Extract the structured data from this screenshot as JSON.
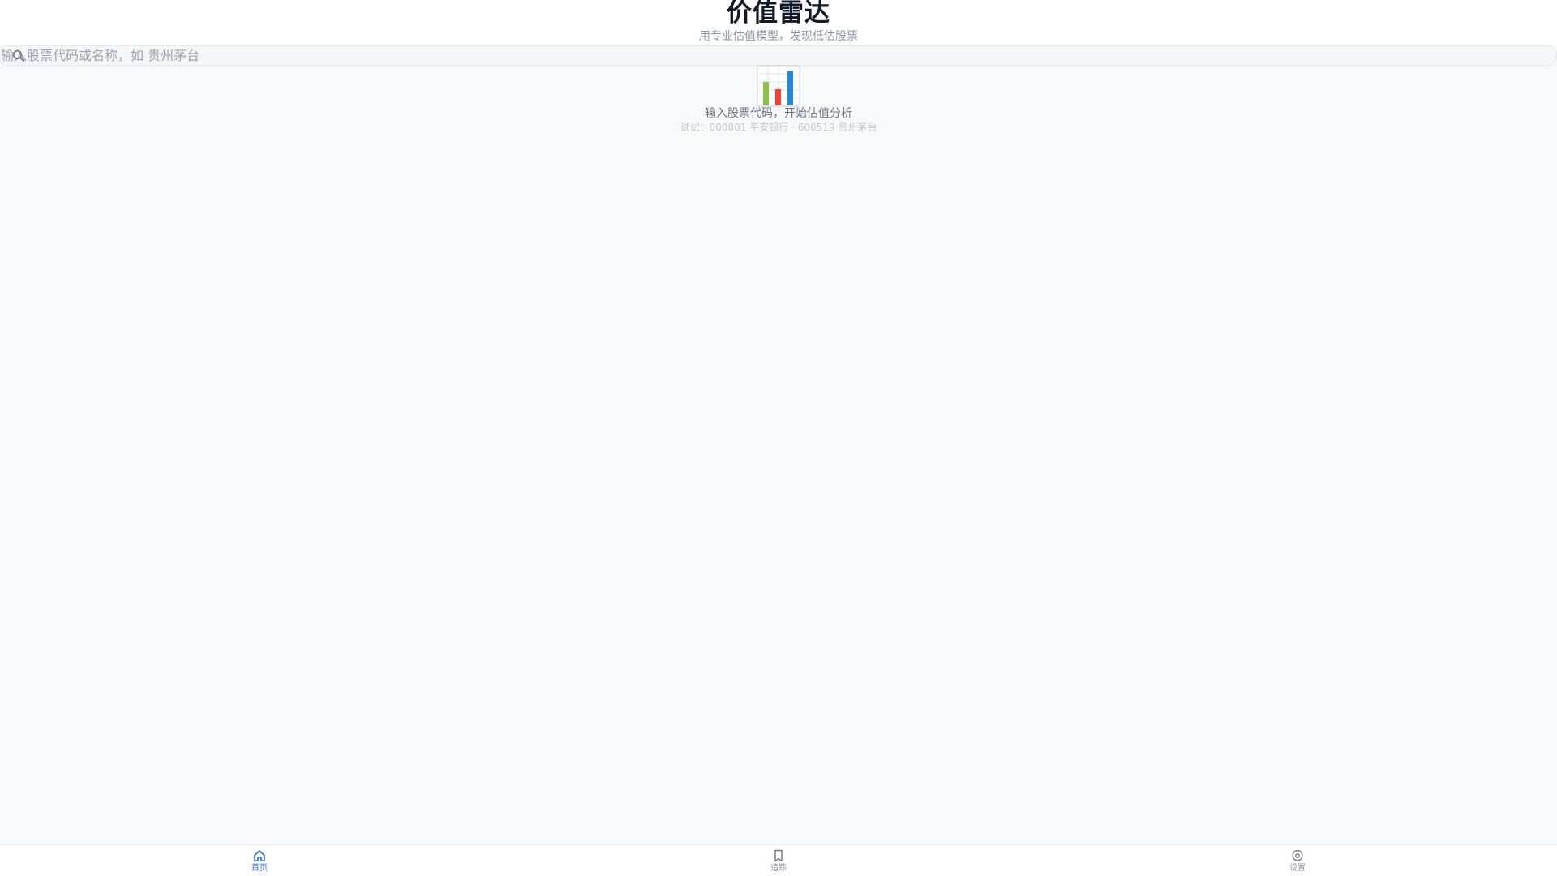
{
  "header": {
    "title": "价值雷达",
    "subtitle": "用专业估值模型，发现低估股票"
  },
  "search": {
    "placeholder": "输入股票代码或名称，如 贵州茅台",
    "icon": "search-icon"
  },
  "empty_state": {
    "icon": "bar-chart-icon",
    "title": "输入股票代码，开始估值分析",
    "hint": "试试：000001 平安银行 · 600519 贵州茅台"
  },
  "tabbar": {
    "active": "home",
    "accent_color": "#2f6fe4",
    "items": [
      {
        "id": "home",
        "label": "首页",
        "icon": "home-icon"
      },
      {
        "id": "track",
        "label": "追踪",
        "icon": "bookmark-icon"
      },
      {
        "id": "settings",
        "label": "设置",
        "icon": "gear-icon"
      }
    ]
  }
}
